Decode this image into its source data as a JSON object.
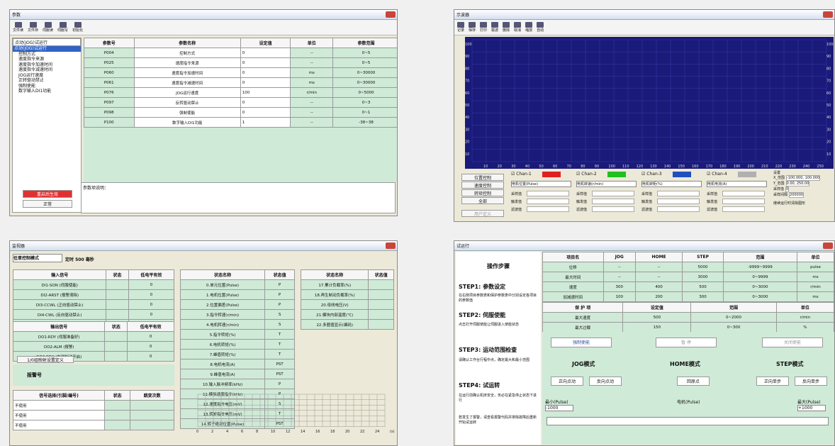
{
  "w1": {
    "title": "参数",
    "toolbar": [
      "文件读",
      "文件存",
      "伺服读",
      "伺服写",
      "初始化"
    ],
    "combo": "点动(JOG)试运行",
    "tree": [
      "点动(JOG)试运行",
      "控制方式",
      "速度指令来源",
      "速度指令加速时间",
      "速度指令减速时间",
      "JOG运行速度",
      "正转驱动禁止",
      "强制使能",
      "数字输入DI1功能"
    ],
    "headers": [
      "参数号",
      "参数名称",
      "设定值",
      "单位",
      "参数范围"
    ],
    "rows": [
      [
        "P004",
        "控制方式",
        "0",
        "--",
        "0~5"
      ],
      [
        "P025",
        "速度指令来源",
        "0",
        "--",
        "0~5"
      ],
      [
        "P060",
        "速度指令加速时间",
        "0",
        "ms",
        "0~30000"
      ],
      [
        "P061",
        "速度指令减速时间",
        "0",
        "ms",
        "0~30000"
      ],
      [
        "P076",
        "JOG运行速度",
        "100",
        "r/min",
        "0~5000"
      ],
      [
        "P097",
        "反转驱动禁止",
        "0",
        "--",
        "0~3"
      ],
      [
        "P098",
        "强制使能",
        "0",
        "--",
        "0~1"
      ],
      [
        "P100",
        "数字输入DI1功能",
        "1",
        "--",
        "-38~38"
      ]
    ],
    "note": "参数项说明：",
    "btn_red": "重启后生效",
    "btn_norm": "正常"
  },
  "w2": {
    "title": "示波器",
    "toolbar": [
      "记录",
      "保存",
      "打印",
      "载波",
      "删除",
      "取消",
      "缩放",
      "自动"
    ],
    "xticks": [
      "10",
      "20",
      "30",
      "40",
      "50",
      "60",
      "70",
      "80",
      "90",
      "100",
      "110",
      "120",
      "130",
      "140",
      "150",
      "160",
      "170",
      "180",
      "190",
      "200",
      "210",
      "220",
      "230",
      "240",
      "250"
    ],
    "yticks": [
      "100",
      "90",
      "80",
      "70",
      "60",
      "50",
      "40",
      "30",
      "20",
      "10"
    ],
    "btns": [
      "位置控制",
      "速度控制",
      "转矩控制",
      "全部"
    ],
    "btn_user": "用户定义",
    "chans": [
      {
        "name": "Chan-1",
        "color": "#e02020",
        "sel": "电机位置(Pulse)"
      },
      {
        "name": "Chan-2",
        "color": "#20c020",
        "sel": "电机转速(r/min)"
      },
      {
        "name": "Chan-3",
        "color": "#2050c0",
        "sel": "电机转矩(%)"
      },
      {
        "name": "Chan-4",
        "color": "#b0b0b0",
        "sel": "电机电流(A)"
      }
    ],
    "fields": [
      "采样值",
      "触发值",
      "滤波值"
    ],
    "settings": "设置",
    "xr": "X_范围",
    "xr_val": "-100.000, 100.000",
    "yr": "Y_范围",
    "yr_val": "0.00, 250.00",
    "unit_ms": "ms",
    "trig": "采样值",
    "trig_val": "0",
    "rate": "采样间隔",
    "rate_val": "200000",
    "rate_unit": "50us",
    "cont": "继续运行时清除图形"
  },
  "w3": {
    "title": "监视器",
    "mode": "任意控制模式",
    "timer": "定时 500 毫秒",
    "in_headers": [
      "输入信号",
      "状态",
      "低电平有效"
    ],
    "inputs": [
      "DI1-SON (伺服使能)",
      "DI2-ARST (报警清除)",
      "DI3-CCWL (正向驱动禁止)",
      "DI4-CWL (反向驱动禁止)",
      "DI5-TCCW (正向转矩限制)"
    ],
    "out_headers": [
      "输出信号",
      "状态",
      "低电平有效"
    ],
    "outputs": [
      "DO1-RDY (伺服准备好)",
      "DO2-ALM (报警)",
      "DO3-BRK (电磁制动开启)"
    ],
    "io_btn": "1/0组映射设置定义",
    "alarm": "报警号",
    "st_headers": [
      "状态名称",
      "状态值"
    ],
    "states": [
      [
        "0.单元位置(Pulse)",
        "P"
      ],
      [
        "1.电机位置(Pulse)",
        "P"
      ],
      [
        "2.位置偏差(Pulse)",
        "P"
      ],
      [
        "3.指令转速(r/min)",
        "S"
      ],
      [
        "4.电机转速(r/min)",
        "S"
      ],
      [
        "5.指令转矩(%)",
        "T"
      ],
      [
        "6.电机转矩(%)",
        "T"
      ],
      [
        "7.峰值转矩(%)",
        "T"
      ],
      [
        "8.电机电流(A)",
        "PST"
      ],
      [
        "9.峰值电流(A)",
        "PST"
      ],
      [
        "10.输入脉冲频率(kHz)",
        "P"
      ],
      [
        "11.模拟速度指令(kHz)",
        "P"
      ],
      [
        "12.速度指令电压(mV)",
        "S"
      ],
      [
        "13.转矩指令电压(mV)",
        "T"
      ],
      [
        "14.转子绝对位置(Pulse)",
        "PST"
      ]
    ],
    "st2": [
      [
        "17.累计负载率(%)",
        ""
      ],
      [
        "18.再生制动负载率(%)",
        ""
      ],
      [
        "20.母线电压(V)",
        ""
      ],
      [
        "21.模块内部温度(℃)",
        ""
      ],
      [
        "22.多圈值显示(编码)",
        ""
      ]
    ],
    "sig_headers": [
      "信号选择(引脚/编号)",
      "状态",
      "跳变次数"
    ],
    "sig_rows": [
      "不使用",
      "不使用",
      "不使用"
    ],
    "xticks": [
      "0",
      "2",
      "4",
      "6",
      "8",
      "10",
      "12",
      "14",
      "16",
      "18",
      "20",
      "22",
      "24",
      "(s)"
    ]
  },
  "w4": {
    "title": "试运行",
    "steps_title": "操作步骤",
    "s1": "STEP1: 参数设定",
    "s1d": "在右侧项目参数表和保护参数表中分别设定各项目的参数值",
    "s2": "STEP2: 伺服使能",
    "s2d": "点击打开伺服使能让伺服进入使能状态",
    "s3": "STEP3: 运动范围检查",
    "s3d": "请确认工作台行程中点，确定最大和最小范围",
    "s4": "STEP4: 试运转",
    "s4d": "在运行前确认机床安全，务必在紧急停止状态下进行",
    "s4e": "若发生了报警，请查看报警代码并排除故障后重新开始试运转",
    "ph": [
      "项目名",
      "JOG",
      "HOME",
      "STEP",
      "范围",
      "单位"
    ],
    "prows": [
      [
        "位移",
        "--",
        "--",
        "5000",
        "-9999~9999",
        "pulse"
      ],
      [
        "最大时间",
        "--",
        "--",
        "3000",
        "0~9999",
        "ms"
      ],
      [
        "速度",
        "300",
        "400",
        "500",
        "0~3000",
        "r/min"
      ],
      [
        "加减速时间",
        "100",
        "200",
        "300",
        "0~3000",
        "ms"
      ]
    ],
    "gh": [
      "保 护 项",
      "设定值",
      "范围",
      "单位"
    ],
    "grows": [
      [
        "最大速度",
        "500",
        "0~2000",
        "r/min"
      ],
      [
        "最大过载",
        "150",
        "0~300",
        "%"
      ],
      [
        "旋转范围",
        "10.0",
        "0.1~100",
        "转数"
      ]
    ],
    "b_enable": "强制使能",
    "b_pause": "暂 停",
    "b_off": "关闭使能",
    "jog": "JOG模式",
    "home": "HOME模式",
    "step": "STEP模式",
    "jog1": "正向点动",
    "jog2": "反向点动",
    "home1": "回原点",
    "step1": "正向单步",
    "step2": "反向单步",
    "minl": "最小(Pulse)",
    "curl": "电机(Pulse)",
    "maxl": "最大(Pulse)",
    "minv": "-1000",
    "maxv": "+1000"
  }
}
